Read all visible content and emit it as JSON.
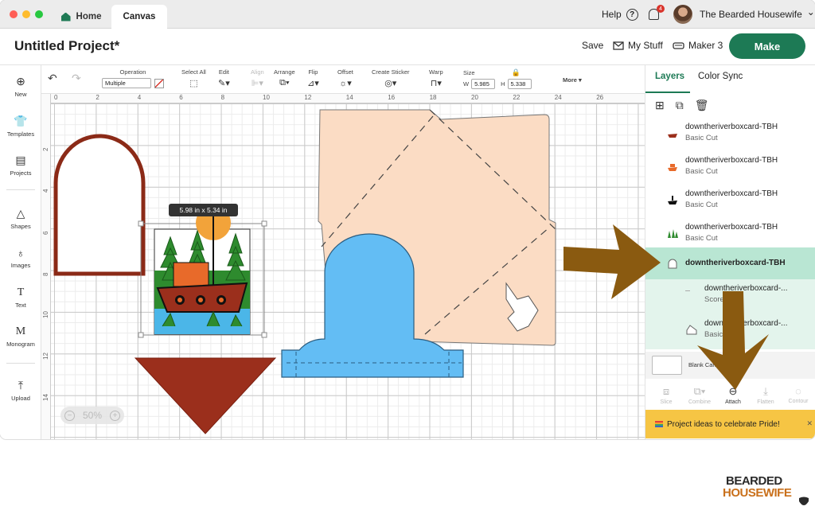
{
  "tabs": {
    "home": "Home",
    "canvas": "Canvas"
  },
  "topbar": {
    "help": "Help",
    "help_glyph": "?",
    "notification_count": "4",
    "account_name": "The Bearded Housewife",
    "account_chevron": "⌄"
  },
  "header": {
    "project_title": "Untitled Project*",
    "save": "Save",
    "my_stuff": "My Stuff",
    "machine": "Maker 3",
    "make": "Make"
  },
  "toolbar": {
    "operation_label": "Operation",
    "operation_value": "Multiple",
    "select_all": "Select All",
    "edit": "Edit",
    "align": "Align",
    "arrange": "Arrange",
    "flip": "Flip",
    "offset": "Offset",
    "create_sticker": "Create Sticker",
    "warp": "Warp",
    "size": "Size",
    "width_label": "W",
    "width_value": "5.985",
    "height_label": "H",
    "height_value": "5.338",
    "more": "More ▾"
  },
  "sidebar": [
    {
      "label": "New",
      "icon": "plus-circle-icon",
      "glyph": "⊕"
    },
    {
      "label": "Templates",
      "icon": "shirt-icon",
      "glyph": "👕"
    },
    {
      "label": "Projects",
      "icon": "projects-icon",
      "glyph": "▤"
    },
    {
      "label": "Shapes",
      "icon": "shapes-icon",
      "glyph": "△"
    },
    {
      "label": "Images",
      "icon": "lightbulb-icon",
      "glyph": "♁"
    },
    {
      "label": "Text",
      "icon": "text-icon",
      "glyph": "T"
    },
    {
      "label": "Monogram",
      "icon": "monogram-icon",
      "glyph": "M"
    },
    {
      "label": "Upload",
      "icon": "upload-icon",
      "glyph": "⤒"
    }
  ],
  "ruler": {
    "top": [
      "0",
      "2",
      "4",
      "6",
      "8",
      "10",
      "12",
      "14",
      "16",
      "18",
      "20",
      "22",
      "24",
      "26"
    ],
    "left": [
      "2",
      "4",
      "6",
      "8",
      "10",
      "12",
      "14"
    ]
  },
  "canvas": {
    "selection_size": "5.98  in x 5.34  in",
    "zoom": "50%"
  },
  "panel": {
    "tab_layers": "Layers",
    "tab_color_sync": "Color Sync",
    "layers": [
      {
        "name": "downtheriverboxcard-TBH",
        "op": "Basic Cut",
        "color": "#9b2f1c"
      },
      {
        "name": "downtheriverboxcard-TBH",
        "op": "Basic Cut",
        "color": "#e86a2a"
      },
      {
        "name": "downtheriverboxcard-TBH",
        "op": "Basic Cut",
        "color": "#111111"
      },
      {
        "name": "downtheriverboxcard-TBH",
        "op": "Basic Cut",
        "color": "#2e8b2e"
      }
    ],
    "group_name": "downtheriverboxcard-TBH",
    "sub_layers": [
      {
        "name": "downtheriverboxcard-...",
        "op": "Score"
      },
      {
        "name": "downtheriverboxcard-...",
        "op": "Basic Cut"
      }
    ],
    "blank_canvas": "Blank Canvas",
    "bottom_tools": [
      "Slice",
      "Combine",
      "Attach",
      "Flatten",
      "Contour"
    ],
    "promo": "Project ideas to celebrate Pride!"
  },
  "logo": {
    "line1": "BEARDED",
    "line2": "HOUSEWIFE"
  },
  "colors": {
    "accent": "#1d7a55",
    "arrow": "#8a5a10",
    "peach": "#fbdcc4",
    "blue": "#63bdf4",
    "brick": "#9b2f1c"
  }
}
